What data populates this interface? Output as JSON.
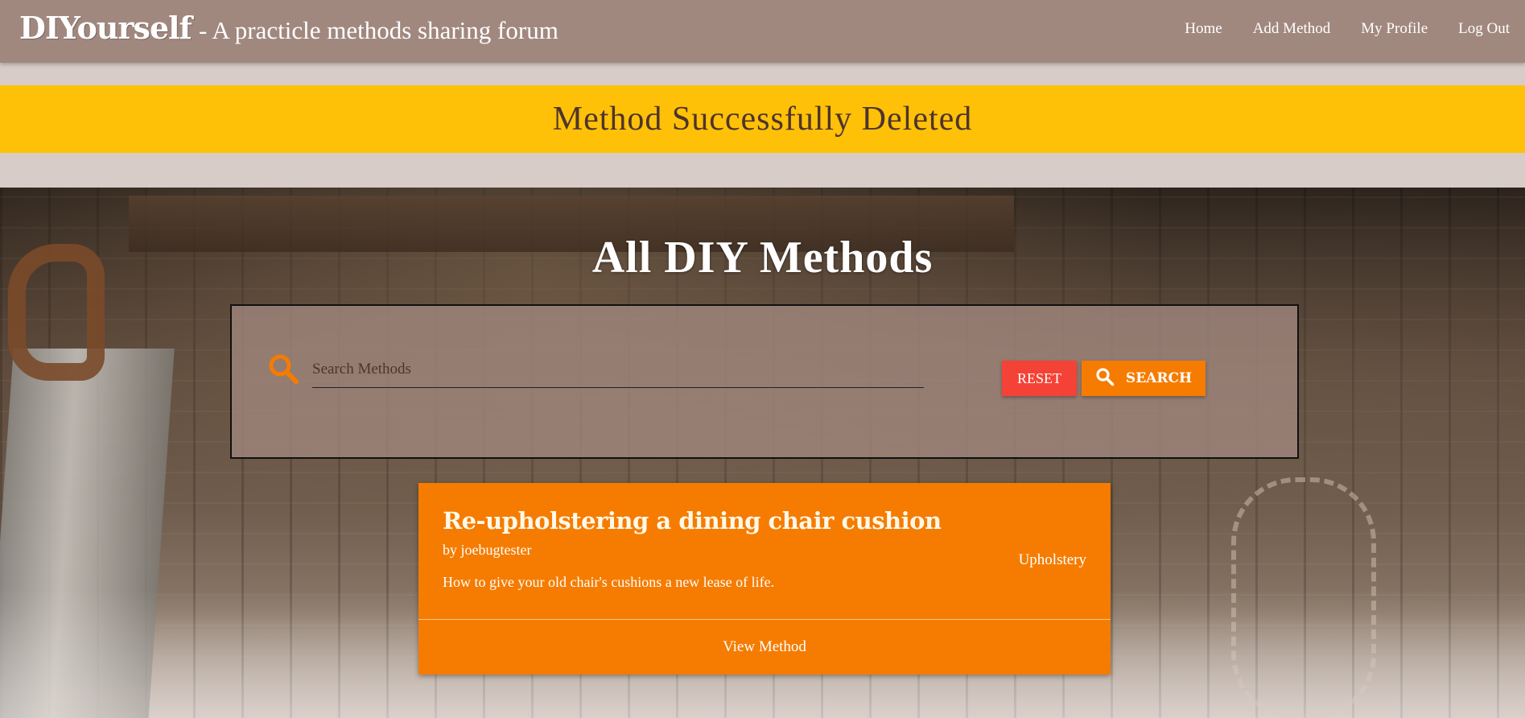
{
  "navbar": {
    "brand_logo": "DIYourself",
    "brand_tagline": "- A practicle methods sharing forum",
    "links": [
      {
        "label": "Home"
      },
      {
        "label": "Add Method"
      },
      {
        "label": "My Profile"
      },
      {
        "label": "Log Out"
      }
    ]
  },
  "alert": {
    "message": "Method Successfully Deleted",
    "color": "#ffc107"
  },
  "main": {
    "title": "All DIY Methods",
    "search": {
      "placeholder": "Search Methods",
      "value": "",
      "icon": "search-icon",
      "reset_label": "RESET",
      "search_label": "SEARCH"
    },
    "methods": [
      {
        "title": "Re-upholstering a dining chair cushion",
        "author": "by joebugtester",
        "description": "How to give your old chair's cushions a new lease of life.",
        "category": "Upholstery",
        "action_label": "View Method"
      }
    ]
  },
  "colors": {
    "navbar": "#a1887f",
    "page_background": "#d7ccc8",
    "accent_orange": "#f57c00",
    "reset_red": "#f44336"
  }
}
